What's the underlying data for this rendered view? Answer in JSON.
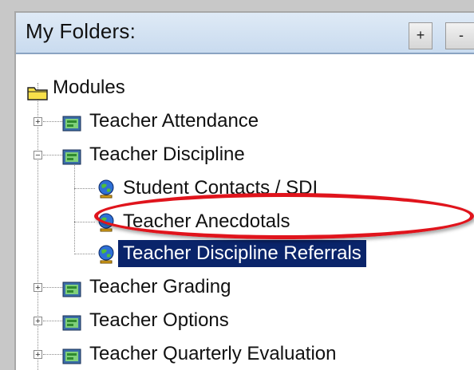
{
  "header": {
    "title": "My Folders:",
    "plus_label": "+",
    "minus_label": "-"
  },
  "tree": {
    "root": {
      "label": "Modules",
      "icon": "folder-icon"
    },
    "items": [
      {
        "label": "Teacher Attendance",
        "expander": "+",
        "icon": "module-icon"
      },
      {
        "label": "Teacher Discipline",
        "expander": "−",
        "icon": "module-icon",
        "children": [
          {
            "label": "Student Contacts / SDI",
            "icon": "globe-icon"
          },
          {
            "label": "Teacher Anecdotals",
            "icon": "globe-icon"
          },
          {
            "label": "Teacher Discipline Referrals",
            "icon": "globe-icon",
            "selected": true
          }
        ]
      },
      {
        "label": "Teacher Grading",
        "expander": "+",
        "icon": "module-icon"
      },
      {
        "label": "Teacher Options",
        "expander": "+",
        "icon": "module-icon"
      },
      {
        "label": "Teacher Quarterly Evaluation",
        "expander": "+",
        "icon": "module-icon"
      }
    ]
  },
  "colors": {
    "selection_bg": "#0a246a",
    "selection_text": "#ffffff",
    "highlight_ring": "#e0141c",
    "header_bg": "#c9dbef"
  }
}
